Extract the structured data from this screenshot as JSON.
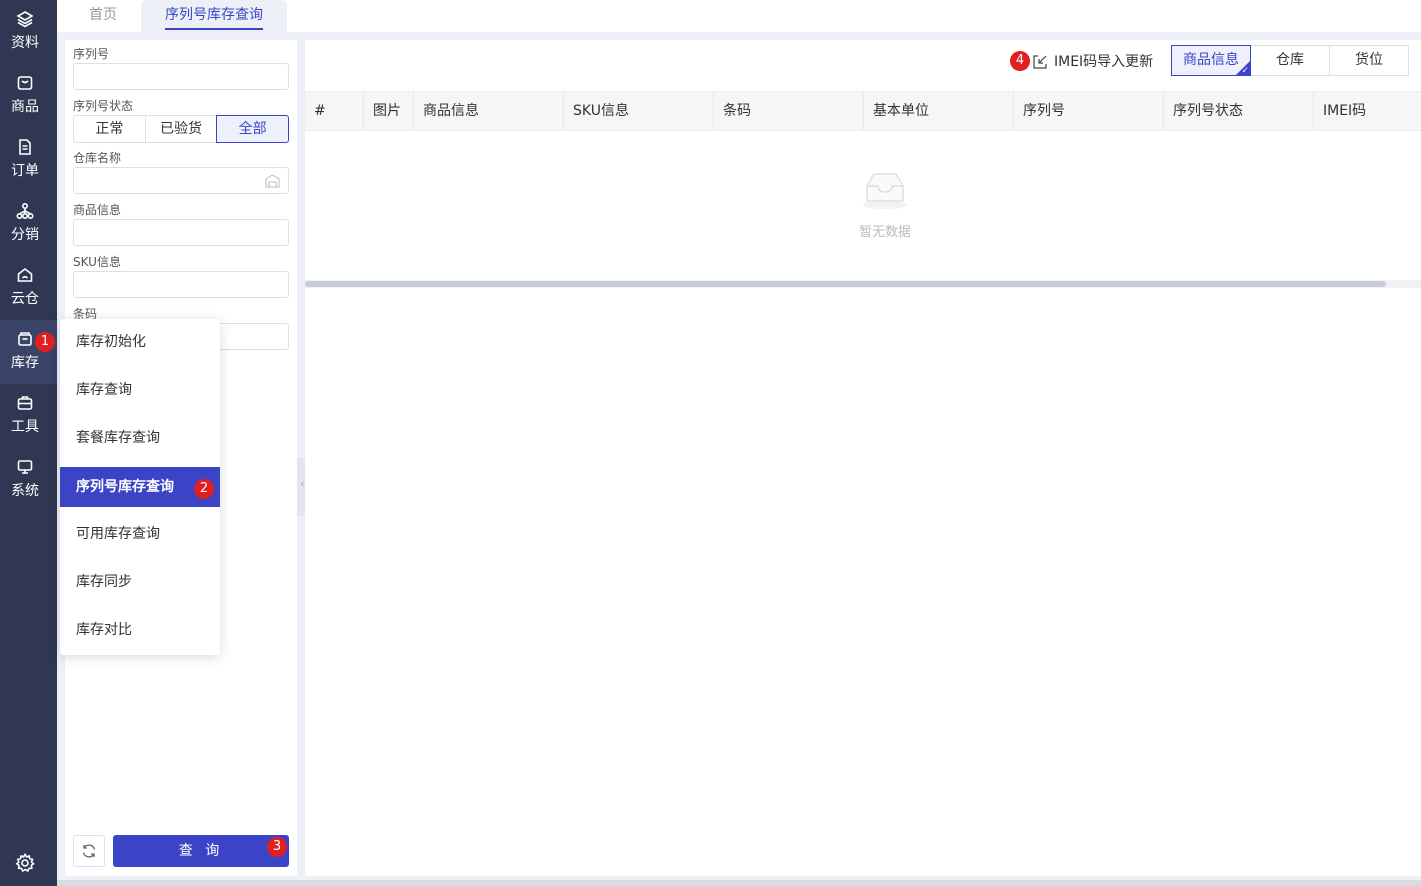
{
  "sidebar": {
    "items": [
      {
        "label": "资料",
        "icon": "layers-icon"
      },
      {
        "label": "商品",
        "icon": "bag-icon"
      },
      {
        "label": "订单",
        "icon": "document-icon"
      },
      {
        "label": "分销",
        "icon": "network-icon"
      },
      {
        "label": "云仓",
        "icon": "cloud-warehouse-icon"
      },
      {
        "label": "库存",
        "icon": "inventory-icon"
      },
      {
        "label": "工具",
        "icon": "toolbox-icon"
      },
      {
        "label": "系统",
        "icon": "monitor-icon"
      }
    ],
    "active": "库存",
    "settings_icon": "gear-icon"
  },
  "tabs": [
    {
      "label": "首页"
    },
    {
      "label": "序列号库存查询"
    }
  ],
  "filter": {
    "serial_label": "序列号",
    "serial_value": "",
    "status_label": "序列号状态",
    "status_options": [
      "正常",
      "已验货",
      "全部"
    ],
    "status_selected": "全部",
    "warehouse_label": "仓库名称",
    "warehouse_value": "",
    "product_label": "商品信息",
    "product_value": "",
    "sku_label": "SKU信息",
    "sku_value": "",
    "barcode_label": "条码",
    "barcode_value": "",
    "query_label": "查 询"
  },
  "menu": {
    "items": [
      "库存初始化",
      "库存查询",
      "套餐库存查询",
      "序列号库存查询",
      "可用库存查询",
      "库存同步",
      "库存对比"
    ],
    "active": "序列号库存查询"
  },
  "badges": [
    "1",
    "2",
    "3",
    "4"
  ],
  "toolbar": {
    "import_label": "IMEI码导入更新",
    "views": [
      "商品信息",
      "仓库",
      "货位"
    ],
    "view_selected": "商品信息"
  },
  "table": {
    "columns": [
      "#",
      "图片",
      "商品信息",
      "SKU信息",
      "条码",
      "基本单位",
      "序列号",
      "序列号状态",
      "IMEI码"
    ],
    "rows": [],
    "empty_text": "暂无数据"
  },
  "colors": {
    "primary": "#3b44c6",
    "sidebar": "#2f3753",
    "badge": "#e02020"
  }
}
